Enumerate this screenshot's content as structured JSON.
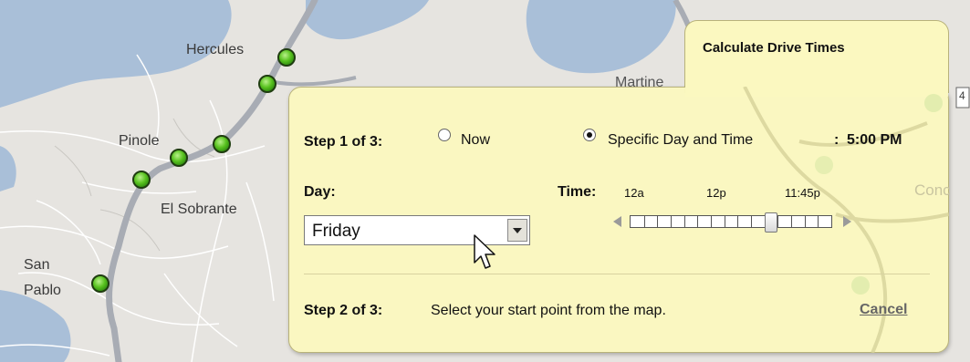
{
  "map": {
    "labels": {
      "hercules": "Hercules",
      "martinez": "Martine",
      "pinole": "Pinole",
      "el_sobrante": "El Sobrante",
      "san": "San",
      "pablo": "Pablo",
      "conc": "Conc",
      "route_shield": "4"
    }
  },
  "panel": {
    "title": "Calculate Drive Times",
    "step1": {
      "label": "Step 1 of 3:",
      "option_now": "Now",
      "option_specific": "Specific Day and Time",
      "selected_time_prefix": ":",
      "selected_time": "5:00 PM",
      "selected_option": "specific"
    },
    "day": {
      "label": "Day:",
      "value": "Friday"
    },
    "time": {
      "label": "Time:",
      "tick_start": "12a",
      "tick_mid": "12p",
      "tick_current": "11:45p",
      "value_fraction": 0.7
    },
    "step2": {
      "label": "Step 2 of 3:",
      "text": "Select your start point from the map."
    },
    "cancel_label": "Cancel"
  },
  "colors": {
    "panel_bg": "#fbf8c0",
    "panel_border": "#b8b27a",
    "stop_green": "#58c21f",
    "water": "#a9bfd8",
    "road": "#a8acb4"
  }
}
